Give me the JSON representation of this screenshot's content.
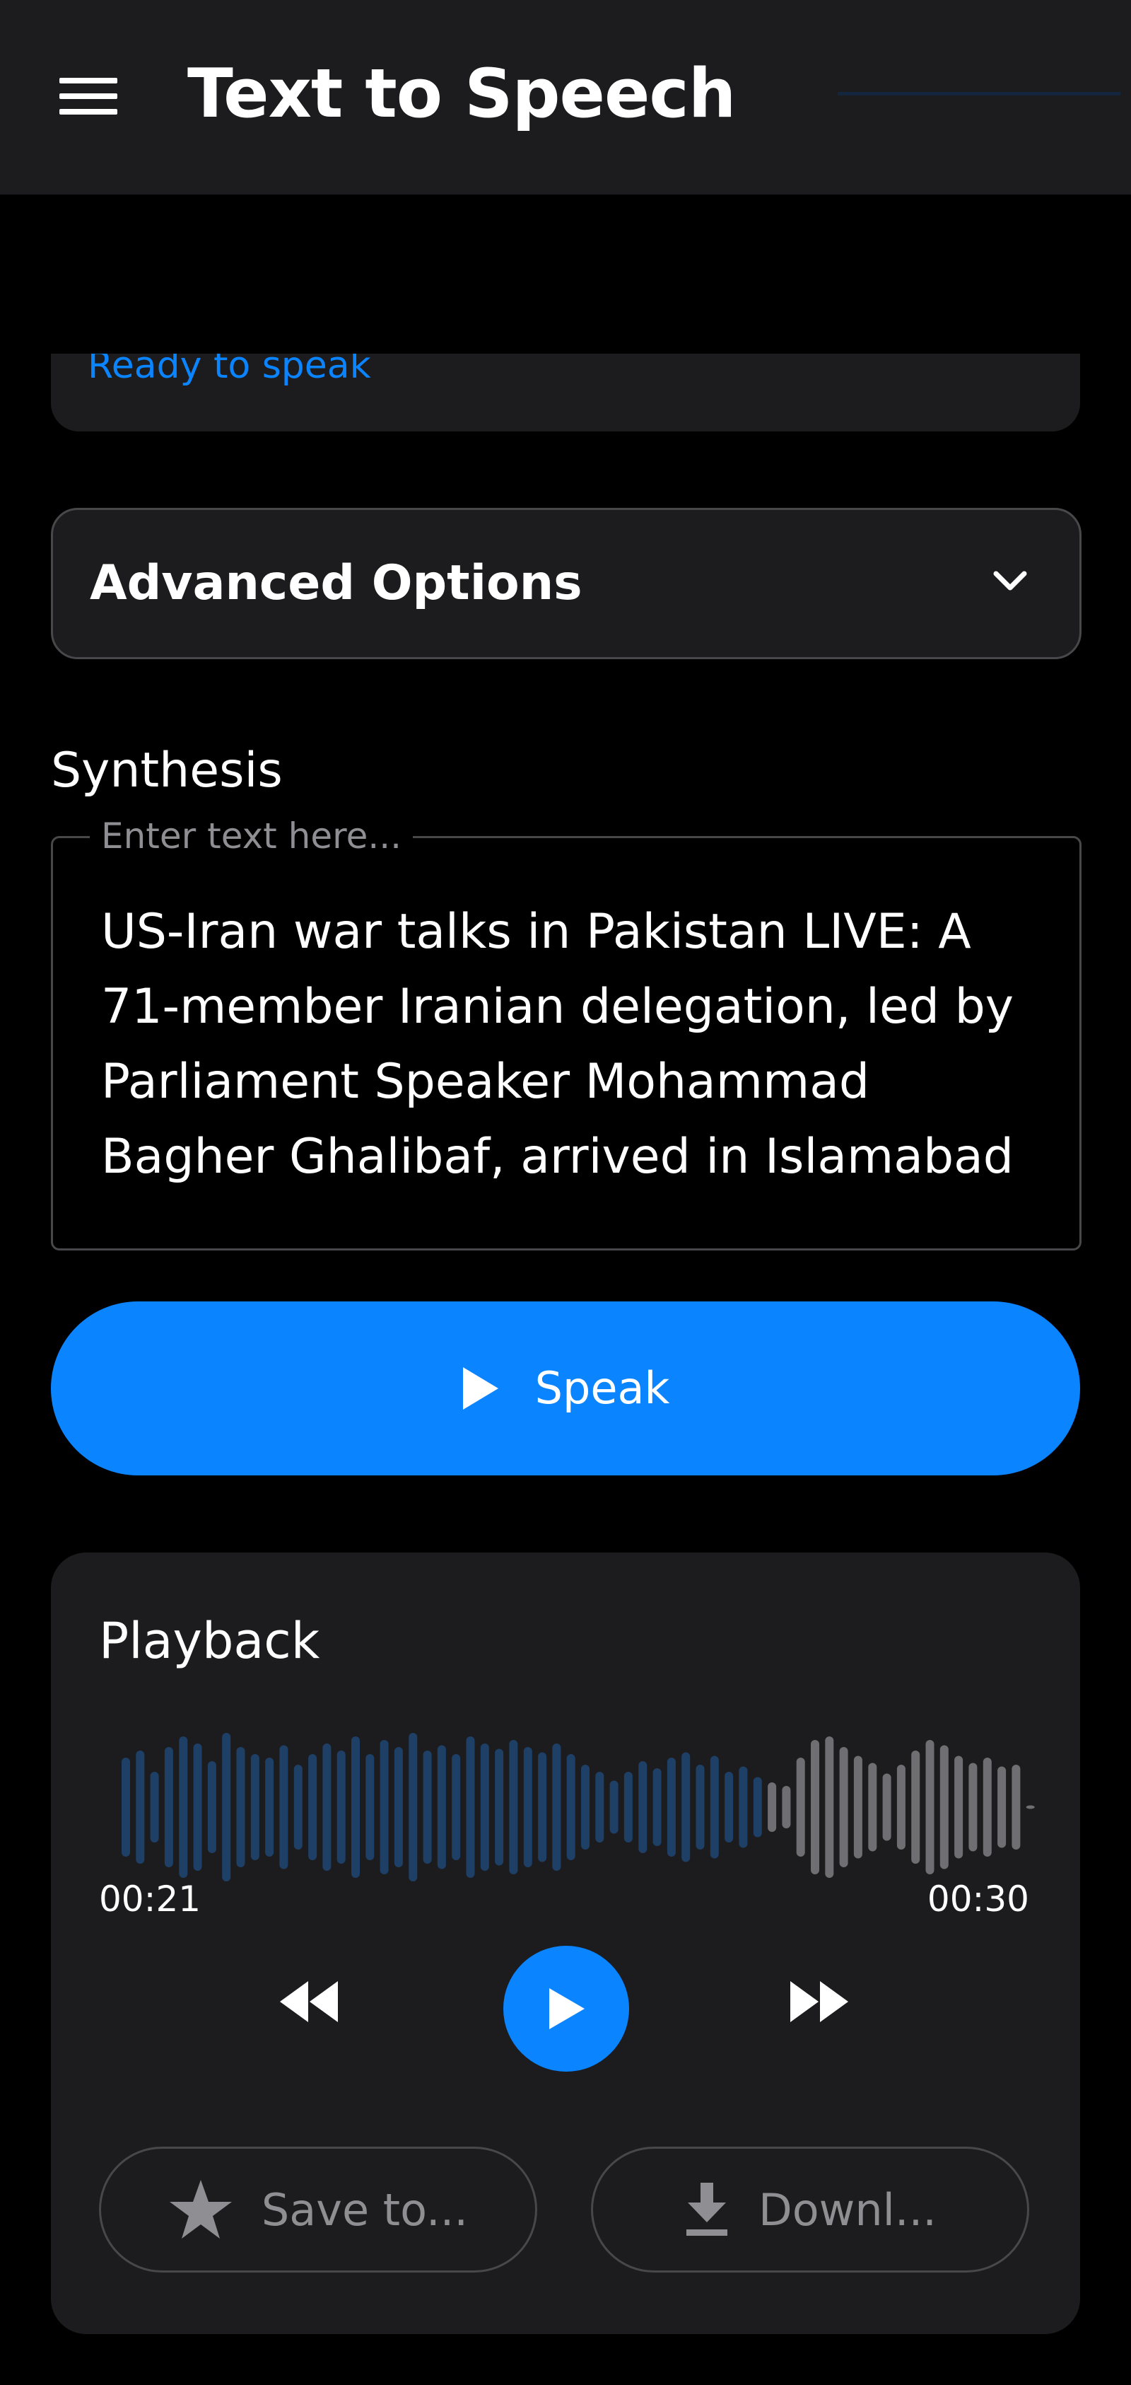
{
  "appbar": {
    "title": "Text to Speech",
    "menu_icon": "hamburger-menu-icon"
  },
  "status": {
    "text": "Ready to speak",
    "color": "#0a84ff"
  },
  "advanced": {
    "label": "Advanced Options",
    "expand_icon": "chevron-down-icon"
  },
  "synthesis": {
    "title": "Synthesis",
    "placeholder": "Enter text here...",
    "text": "US-Iran war talks in Pakistan LIVE: A 71-member Iranian delegation, led by Parliament Speaker Mohammad Bagher Ghalibaf, arrived in Islamabad"
  },
  "speak": {
    "label": "Speak",
    "icon": "play-icon",
    "color": "#0a84ff"
  },
  "playback": {
    "title": "Playback",
    "current_time": "00:21",
    "total_time": "00:30",
    "progress": 0.7,
    "controls": {
      "rewind_icon": "rewind-icon",
      "play_icon": "play-icon",
      "forward_icon": "fast-forward-icon"
    },
    "save_label": "Save to...",
    "save_icon": "star-icon",
    "download_label": "Downl...",
    "download_icon": "download-icon"
  },
  "colors": {
    "accent": "#0a84ff",
    "surface": "#1c1c1e",
    "background": "#000000",
    "wave_played": "#1e3f66",
    "wave_unplayed": "#6e6e73"
  }
}
